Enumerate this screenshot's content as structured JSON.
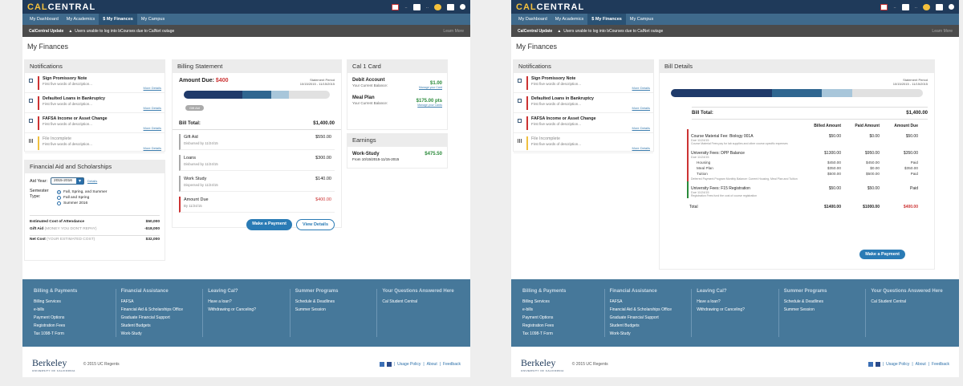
{
  "app": {
    "logo_a": "CAL",
    "logo_b": "CENTRAL",
    "icon_labels": [
      "..",
      "..",
      ".."
    ]
  },
  "nav": [
    "My Dashboard",
    "My Academics",
    "$ My Finances",
    "My Campus"
  ],
  "alert": {
    "label": "CalCentral Update",
    "text": "Users unable to log into bCourses due to CalNet outage",
    "link": "Learn More"
  },
  "page_title": "My Finances",
  "notifications": {
    "title": "Notifications",
    "more": "More Details",
    "items": [
      {
        "title": "Sign Promissory Note",
        "sub": "First five words of description...",
        "color": "#c33"
      },
      {
        "title": "Defaulted Loans in Bankruptcy",
        "sub": "First five words of description...",
        "color": "#c33"
      },
      {
        "title": "FAFSA Income or Asset Change",
        "sub": "First five words of description...",
        "color": "#c33"
      },
      {
        "title": "File Incomplete",
        "sub": "First five words of description...",
        "color": "#f0c040"
      }
    ]
  },
  "fin_aid": {
    "title": "Financial Aid and Scholarships",
    "aid_year_label": "Aid Year:",
    "aid_year": "2015-2016",
    "details": "Details",
    "semester_label": "Semester Type:",
    "options": [
      "Fall, Spring, and Summer",
      "Fall and Spring",
      "Summer 2016"
    ],
    "rows": [
      {
        "k": "Estimated Cost of Attendance",
        "v": "$50,000"
      },
      {
        "k": "Gift Aid",
        "note": "(MONEY YOU DON'T REPAY)",
        "v": "-$18,000"
      },
      {
        "k": "Net Cost",
        "note": "(YOUR ESTIMATED COST)",
        "v": "$32,000"
      }
    ]
  },
  "billing": {
    "title": "Billing Statement",
    "amount_due_label": "Amount Due:",
    "amount_due": "$400",
    "period_label": "Statement Period",
    "period": "10/15/2015 - 11/15/2015",
    "pill": "Gift Aid",
    "progress": [
      0.4,
      0.2,
      0.12
    ],
    "bill_total_label": "Bill Total:",
    "bill_total": "$1,400.00",
    "items": [
      {
        "name": "Gift Aid",
        "sub": "Disbursed by 11/24/15",
        "value": "$550.00"
      },
      {
        "name": "Loans",
        "sub": "Disbursed by 11/24/15",
        "value": "$300.00"
      },
      {
        "name": "Work Study",
        "sub": "Dispersed by 11/24/15",
        "value": "$140.00"
      },
      {
        "name": "Amount Due",
        "sub": "By 11/24/15",
        "value": "$400.00"
      }
    ],
    "make_payment": "Make a Payment",
    "view_details": "View Details"
  },
  "cal1": {
    "title": "Cal 1 Card",
    "debit": "Debit Account",
    "debit_sub": "Your Current Balance:",
    "debit_val": "$1.00",
    "manage": "Manage your Card",
    "meal": "Meal Plan",
    "meal_sub": "Your Current Balance:",
    "meal_val": "$175.00 pts",
    "manage2": "Manage your Cards"
  },
  "earnings": {
    "title": "Earnings",
    "name": "Work-Study",
    "sub": "From 10/15/2015-11/15-2015",
    "value": "$475.50"
  },
  "bill_details": {
    "title": "Bill Details",
    "period_label": "Statement Period",
    "period": "10/15/2015 - 11/15/2015",
    "bill_total_label": "Bill Total:",
    "bill_total": "$1,400.00",
    "cols": [
      "Billed Amount",
      "Paid Amount",
      "Amount Due"
    ],
    "rows": [
      {
        "name": "Course Material Fee: Biology 001A",
        "sub": "Due 11/24/15",
        "desc": "Course Material Fees pay for lab supplies and other course-specific expenses",
        "billed": "$50.00",
        "paid": "$0.00",
        "due": "$50.00",
        "color": "#c33"
      },
      {
        "name": "University Fees: DPP Balance",
        "sub": "Due 11/24/15",
        "desc": "Deferred Payment Program Monthly Balance: Current Housing, Meal Plan and Tuition",
        "billed": "$1300.00",
        "paid": "$950.00",
        "due": "$350.00",
        "color": "#c33",
        "subs": [
          {
            "n": "Housing",
            "b": "$450.00",
            "p": "$450.00",
            "d": "Paid"
          },
          {
            "n": "Meal Plan",
            "b": "$350.00",
            "p": "$0.00",
            "d": "$350.00"
          },
          {
            "n": "Tuition",
            "b": "$500.00",
            "p": "$500.00",
            "d": "Paid"
          }
        ]
      },
      {
        "name": "University Fees: F15 Registration",
        "sub": "Due 11/24/15",
        "desc": "Registration Fees fund the cost of course registration",
        "billed": "$50.00",
        "paid": "$50.00",
        "due": "Paid",
        "color": "#2a8a3a"
      }
    ],
    "total_label": "Total",
    "total": [
      "$1400.00",
      "$1000.00",
      "$400.00"
    ],
    "make_payment": "Make a Payment"
  },
  "footer": [
    {
      "h": "Billing & Payments",
      "links": [
        "Billing Services",
        "e-bills",
        "Payment Options",
        "Registration Fees",
        "Tax 1098-T Form"
      ]
    },
    {
      "h": "Financial Assistance",
      "links": [
        "FAFSA",
        "Financial Aid & Scholarships Office",
        "Graduate Financial Support",
        "Student Budgets",
        "Work-Study"
      ]
    },
    {
      "h": "Leaving Cal?",
      "links": [
        "Have a loan?",
        "Withdrawing or Canceling?"
      ]
    },
    {
      "h": "Summer Programs",
      "links": [
        "Schedule & Deadlines",
        "Summer Session"
      ]
    },
    {
      "h": "Your Questions Answered Here",
      "links": [
        "Cal Student Central"
      ]
    }
  ],
  "bottom": {
    "berkeley": "Berkeley",
    "univ": "UNIVERSITY OF CALIFORNIA",
    "copy": "© 2015 UC Regents",
    "links": [
      "Usage Policy",
      "About",
      "Feedback"
    ]
  }
}
